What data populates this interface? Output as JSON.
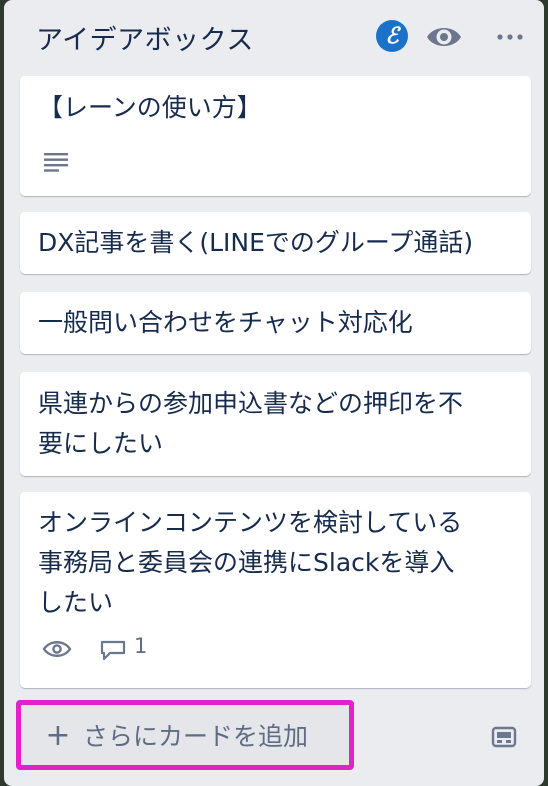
{
  "list": {
    "title": "アイデアボックス",
    "header_icons": [
      "e-badge-icon",
      "eye-icon",
      "more-icon"
    ],
    "badge_letter": "ℰ"
  },
  "cards": [
    {
      "title_lines": [
        "【レーンの使い方】"
      ],
      "badges": [
        "description-icon"
      ]
    },
    {
      "title_lines": [
        "DX記事を書く(LINEでのグループ通話)"
      ]
    },
    {
      "title_lines": [
        "一般問い合わせをチャット対応化"
      ]
    },
    {
      "title_lines": [
        "県連からの参加申込書などの押印を不",
        "要にしたい"
      ]
    },
    {
      "title_lines": [
        "オンラインコンテンツを検討している",
        "事務局と委員会の連携にSlackを導入",
        "したい"
      ],
      "badges": [
        "eye-icon",
        "comment-icon"
      ],
      "comment_count": "1"
    }
  ],
  "add_card": {
    "plus": "+",
    "label": "さらにカードを追加"
  },
  "colors": {
    "highlight": "#e320c9",
    "list_bg": "#ebecf0",
    "badge_blue": "#1a73c8"
  }
}
